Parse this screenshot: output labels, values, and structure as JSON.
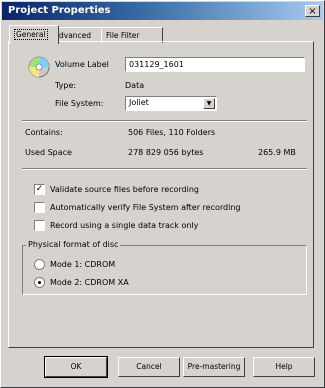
{
  "window": {
    "title": "Project Properties",
    "close_glyph": "×"
  },
  "tabs": [
    {
      "label": "General"
    },
    {
      "label": "Advanced"
    },
    {
      "label": "File Filter"
    }
  ],
  "general": {
    "volume_label_caption": "Volume Label",
    "volume_label_value": "031129_1601",
    "type_caption": "Type:",
    "type_value": "Data",
    "file_system_caption": "File System:",
    "file_system_value": "Joliet",
    "contains_caption": "Contains:",
    "contains_value": "506 Files, 110 Folders",
    "used_space_caption": "Used Space",
    "used_space_bytes": "278 829 056 bytes",
    "used_space_mb": "265.9 MB"
  },
  "options": [
    {
      "label": "Validate source files before recording",
      "checked": true
    },
    {
      "label": "Automatically verify File System after recording",
      "checked": false
    },
    {
      "label": "Record using a single data track only",
      "checked": false
    }
  ],
  "physical_format": {
    "title": "Physical format of disc",
    "mode1": "Mode 1: CDROM",
    "mode2": "Mode 2: CDROM XA",
    "selected": "mode2"
  },
  "buttons": {
    "ok": "OK",
    "cancel": "Cancel",
    "apply": "Pre-mastering",
    "help": "Help"
  },
  "icons": {
    "cd": "cd-disc-icon",
    "dropdown": "chevron-down-icon",
    "check": "check-icon"
  },
  "colors": {
    "titlebar_start": "#0a246a",
    "titlebar_end": "#a6caf0",
    "face": "#d6d3ce"
  }
}
